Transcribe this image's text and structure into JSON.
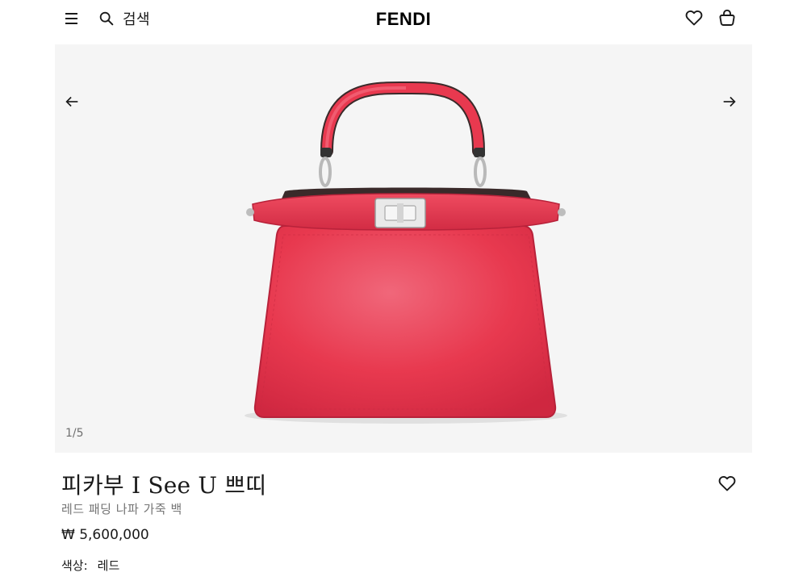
{
  "header": {
    "menu_icon": "hamburger-menu-icon",
    "search_icon": "search-icon",
    "search_label": "검색",
    "logo": "FENDI",
    "wishlist_icon": "heart-icon",
    "bag_icon": "shopping-bag-icon"
  },
  "gallery": {
    "prev_icon": "arrow-left-icon",
    "next_icon": "arrow-right-icon",
    "counter": "1/5",
    "image": "red-peekaboo-handbag",
    "background": "#f5f5f5"
  },
  "product": {
    "title": "피카부 I See U 쁘띠",
    "subtitle": "레드 패딩 나파 가죽 백",
    "price": "₩ 5,600,000",
    "color_label": "색상:",
    "color_value": "레드",
    "wishlist_icon": "heart-icon"
  },
  "colors": {
    "bag_red": "#e8394f",
    "text": "#1a1a1a",
    "muted": "#757575"
  }
}
